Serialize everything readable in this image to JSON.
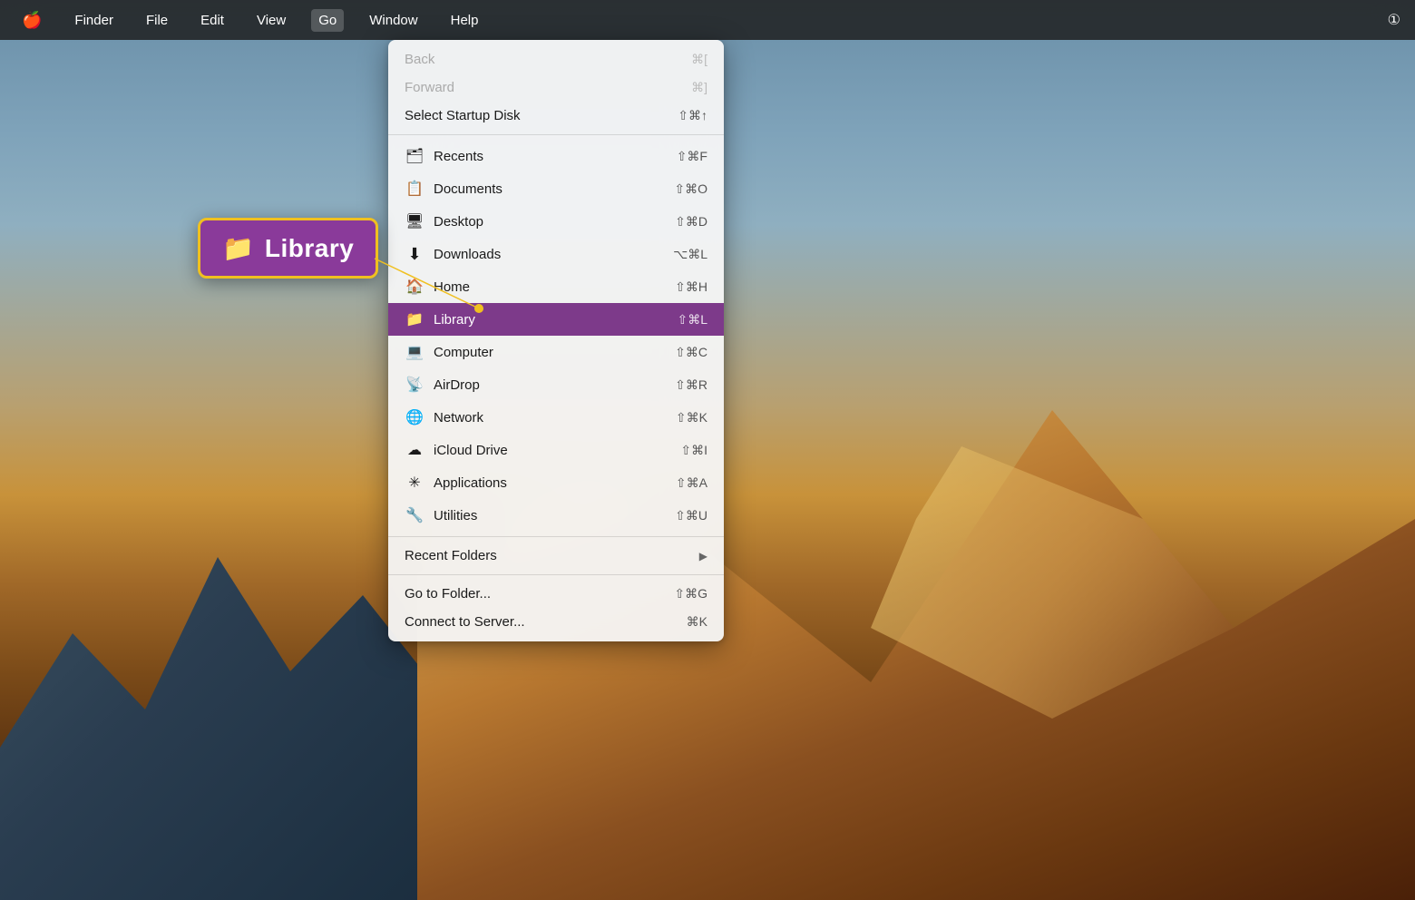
{
  "menubar": {
    "apple_icon": "🍎",
    "items": [
      {
        "id": "finder",
        "label": "Finder"
      },
      {
        "id": "file",
        "label": "File"
      },
      {
        "id": "edit",
        "label": "Edit"
      },
      {
        "id": "view",
        "label": "View"
      },
      {
        "id": "go",
        "label": "Go",
        "active": true
      },
      {
        "id": "window",
        "label": "Window"
      },
      {
        "id": "help",
        "label": "Help"
      }
    ],
    "right_icon": "①"
  },
  "dropdown": {
    "items": [
      {
        "id": "back",
        "label": "Back",
        "shortcut": "⌘[",
        "disabled": true,
        "icon": ""
      },
      {
        "id": "forward",
        "label": "Forward",
        "shortcut": "⌘]",
        "disabled": true,
        "icon": ""
      },
      {
        "id": "startup-disk",
        "label": "Select Startup Disk",
        "shortcut": "⇧⌘↑",
        "disabled": false,
        "icon": ""
      },
      {
        "separator": true
      },
      {
        "id": "recents",
        "label": "Recents",
        "shortcut": "⇧⌘F",
        "disabled": false,
        "icon": "🗂"
      },
      {
        "id": "documents",
        "label": "Documents",
        "shortcut": "⇧⌘O",
        "disabled": false,
        "icon": "📋"
      },
      {
        "id": "desktop",
        "label": "Desktop",
        "shortcut": "⇧⌘D",
        "disabled": false,
        "icon": "🖥"
      },
      {
        "id": "downloads",
        "label": "Downloads",
        "shortcut": "⌥⌘L",
        "disabled": false,
        "icon": "⬇"
      },
      {
        "id": "home",
        "label": "Home",
        "shortcut": "⇧⌘H",
        "disabled": false,
        "icon": "🏠"
      },
      {
        "id": "library",
        "label": "Library",
        "shortcut": "⇧⌘L",
        "disabled": false,
        "icon": "📁",
        "highlighted": true
      },
      {
        "id": "computer",
        "label": "Computer",
        "shortcut": "⇧⌘C",
        "disabled": false,
        "icon": "💻"
      },
      {
        "id": "airdrop",
        "label": "AirDrop",
        "shortcut": "⇧⌘R",
        "disabled": false,
        "icon": "📡"
      },
      {
        "id": "network",
        "label": "Network",
        "shortcut": "⇧⌘K",
        "disabled": false,
        "icon": "🌐"
      },
      {
        "id": "icloud-drive",
        "label": "iCloud Drive",
        "shortcut": "⇧⌘I",
        "disabled": false,
        "icon": "☁"
      },
      {
        "id": "applications",
        "label": "Applications",
        "shortcut": "⇧⌘A",
        "disabled": false,
        "icon": "✳"
      },
      {
        "id": "utilities",
        "label": "Utilities",
        "shortcut": "⇧⌘U",
        "disabled": false,
        "icon": "🔧"
      },
      {
        "separator": true
      },
      {
        "id": "recent-folders",
        "label": "Recent Folders",
        "shortcut": "▶",
        "disabled": false,
        "icon": "",
        "submenu": true
      },
      {
        "separator": true
      },
      {
        "id": "go-to-folder",
        "label": "Go to Folder...",
        "shortcut": "⇧⌘G",
        "disabled": false,
        "icon": ""
      },
      {
        "id": "connect-to-server",
        "label": "Connect to Server...",
        "shortcut": "⌘K",
        "disabled": false,
        "icon": ""
      }
    ]
  },
  "callout": {
    "icon": "📁",
    "label": "Library"
  }
}
